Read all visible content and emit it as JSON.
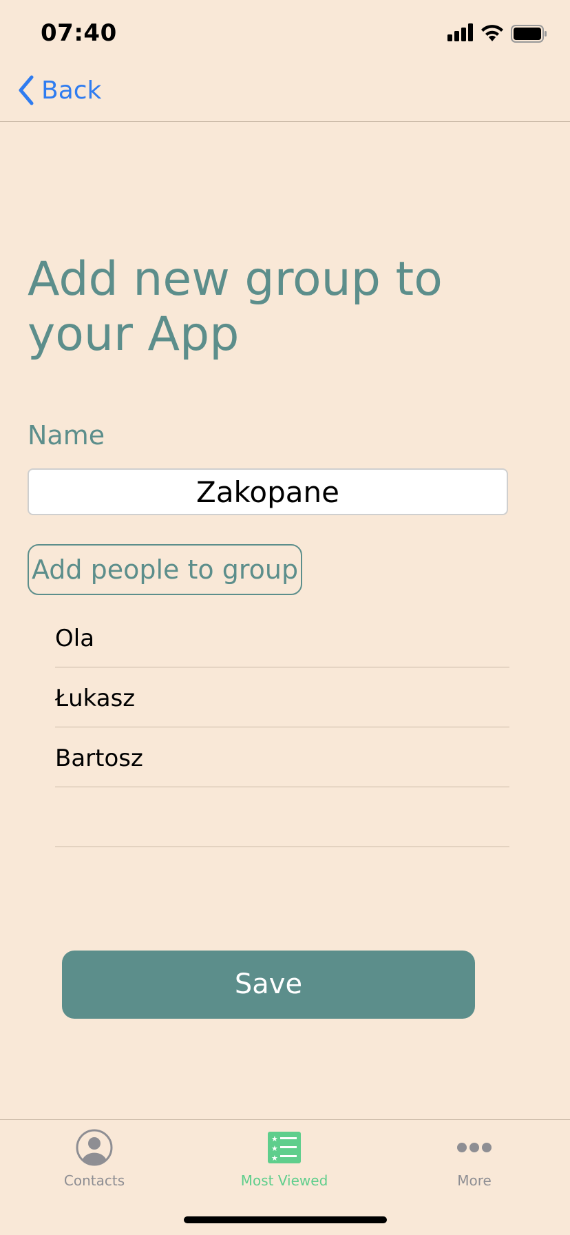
{
  "status_bar": {
    "time": "07:40",
    "icons": [
      "signal-icon",
      "wifi-icon",
      "battery-icon"
    ]
  },
  "nav": {
    "back_label": "Back",
    "back_icon": "chevron-left-icon"
  },
  "page": {
    "title": "Add new group to your App",
    "name_label": "Name",
    "name_value": "Zakopane",
    "add_people_label": "Add people to group",
    "people": [
      "Ola",
      "Łukasz",
      "Bartosz",
      ""
    ],
    "save_label": "Save"
  },
  "tab_bar": {
    "items": [
      {
        "label": "Contacts",
        "icon": "contacts-icon",
        "color": "#8e8e93"
      },
      {
        "label": "Most Viewed",
        "icon": "most-viewed-icon",
        "color": "#5fce8c",
        "selected": true
      },
      {
        "label": "More",
        "icon": "more-icon",
        "color": "#8e8e93"
      }
    ]
  },
  "colors": {
    "background": "#f9e8d7",
    "accent": "#5c8e8b",
    "link": "#2f7cf0",
    "selected_tab": "#5fce8c"
  }
}
